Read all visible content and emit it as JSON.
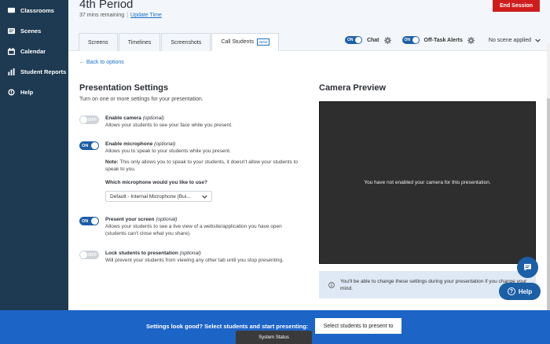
{
  "sidebar": {
    "items": [
      {
        "label": "Classrooms",
        "icon": "classroom-icon"
      },
      {
        "label": "Scenes",
        "icon": "scenes-icon"
      },
      {
        "label": "Calendar",
        "icon": "calendar-icon"
      },
      {
        "label": "Student Reports",
        "icon": "reports-icon"
      },
      {
        "label": "Help",
        "icon": "help-icon"
      }
    ]
  },
  "header": {
    "title": "4th Period",
    "time_remaining": "37 mins remaining",
    "separator": "|",
    "update_time": "Update Time",
    "end_session": "End Session"
  },
  "tabs": [
    {
      "label": "Screens",
      "active": false
    },
    {
      "label": "Timelines",
      "active": false
    },
    {
      "label": "Screenshots",
      "active": false
    },
    {
      "label": "Call Students",
      "active": true,
      "badge": "NEW"
    }
  ],
  "controls": {
    "chat_toggle": "ON",
    "chat_label": "Chat",
    "offtask_toggle": "ON",
    "offtask_label": "Off-Task Alerts",
    "scene_select": "No scene applied"
  },
  "main": {
    "back_link": "← Back to options",
    "section_title": "Presentation Settings",
    "section_sub": "Turn on one or more settings for your presentation.",
    "settings": [
      {
        "state": "OFF",
        "name": "Enable camera",
        "optional": "(optional)",
        "desc": "Allows your students to see your face while you present."
      },
      {
        "state": "ON",
        "name": "Enable microphone",
        "optional": "(optional)",
        "desc": "Allows you to speak to your students while you present.",
        "note_label": "Note:",
        "note": "This only allows you to speak to your students, it doesn't allow your students to speak to you.",
        "mic_question": "Which microphone would you like to use?",
        "mic_selected": "Default - Internal Microphone (Bui..."
      },
      {
        "state": "ON",
        "name": "Present your screen",
        "optional": "(optional)",
        "desc": "Allows your students to see a live view of a website/application you have open (students can't close what you share)."
      },
      {
        "state": "OFF",
        "name": "Lock students to presentation",
        "optional": "(optional)",
        "desc": "Will prevent your students from viewing any other tab until you stop presenting."
      }
    ],
    "camera_title": "Camera Preview",
    "camera_message": "You have not enabled your camera for this presentation.",
    "info_text": "You'll be able to change these settings during your presentation if you change your mind."
  },
  "help_button": "Help",
  "footer": {
    "prompt": "Settings look good? Select students and start presenting:",
    "button": "Select students to present to",
    "system_status": "System Status"
  },
  "colors": {
    "sidebar": "#1e3a52",
    "accent": "#1b5fa6",
    "danger": "#cf1d1d",
    "footer": "#1c64c6"
  }
}
